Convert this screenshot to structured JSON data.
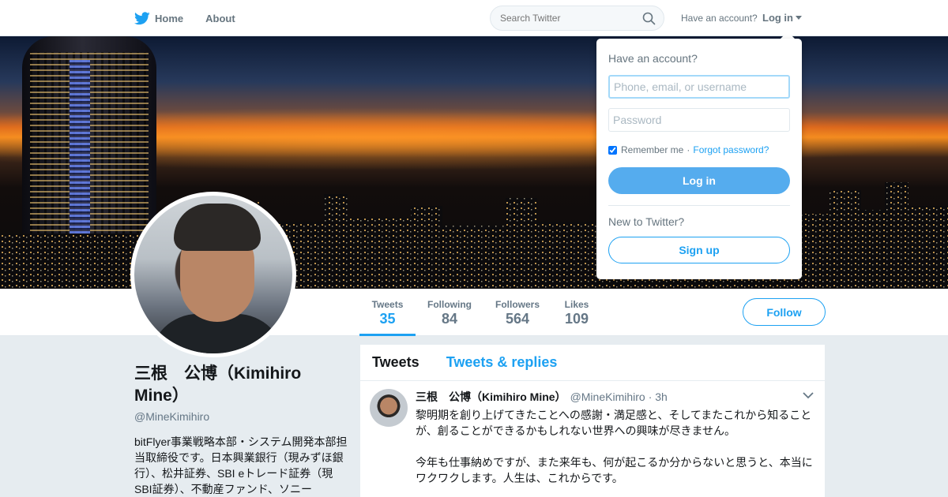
{
  "nav": {
    "home_label": "Home",
    "about_label": "About",
    "search_placeholder": "Search Twitter",
    "have_account": "Have an account?",
    "login_label": "Log in"
  },
  "colors": {
    "accent": "#1da1f2",
    "login_button": "#55acee",
    "background": "#e6ecf0"
  },
  "icons": [
    "twitter-bird-icon",
    "search-icon",
    "caret-down-icon",
    "chevron-down-icon"
  ],
  "profile": {
    "name": "三根　公博（Kimihiro Mine）",
    "handle": "@MineKimihiro",
    "bio": "bitFlyer事業戦略本部・システム開発本部担当取締役です。日本興業銀行（現みずほ銀行）、松井証券、SBI eトレード証券（現SBI証券）、不動産ファンド、ソニー"
  },
  "stats": [
    {
      "label": "Tweets",
      "value": "35"
    },
    {
      "label": "Following",
      "value": "84"
    },
    {
      "label": "Followers",
      "value": "564"
    },
    {
      "label": "Likes",
      "value": "109"
    }
  ],
  "follow_label": "Follow",
  "timeline": {
    "tabs": [
      "Tweets",
      "Tweets & replies"
    ],
    "tweet": {
      "name": "三根　公博（Kimihiro Mine）",
      "handle": "@MineKimihiro",
      "time": "· 3h",
      "text": "黎明期を創り上げてきたことへの感謝・満足感と、そしてまたこれから知ることが、創ることができるかもしれない世界への興味が尽きません。\n\n今年も仕事納めですが、また来年も、何が起こるか分からないと思うと、本当にワクワクします。人生は、これからです。"
    }
  },
  "login_dropdown": {
    "heading": "Have an account?",
    "username_placeholder": "Phone, email, or username",
    "password_placeholder": "Password",
    "remember_me": "Remember me",
    "separator": "·",
    "forgot_password": "Forgot password?",
    "login_button": "Log in",
    "new_to_twitter": "New to Twitter?",
    "signup_button": "Sign up"
  }
}
